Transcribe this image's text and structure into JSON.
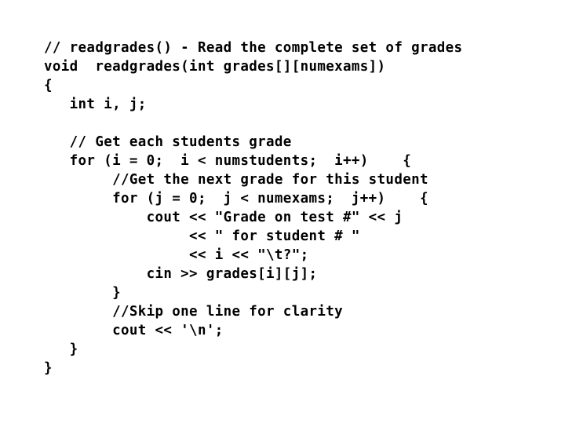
{
  "page": {
    "kind": "code-listing-slide",
    "language": "C++",
    "background_color": "#ffffff",
    "text_color": "#000000"
  },
  "code": {
    "function_name": "readgrades",
    "lines": [
      "// readgrades() - Read the complete set of grades",
      "void  readgrades(int grades[][numexams])",
      "{",
      "   int i, j;",
      "",
      "   // Get each students grade",
      "   for (i = 0;  i < numstudents;  i++)    {",
      "        //Get the next grade for this student",
      "        for (j = 0;  j < numexams;  j++)    {",
      "            cout << \"Grade on test #\" << j",
      "                 << \" for student # \"",
      "                 << i << \"\\t?\";",
      "            cin >> grades[i][j];",
      "        }",
      "        //Skip one line for clarity",
      "        cout << '\\n';",
      "   }",
      "}"
    ]
  }
}
